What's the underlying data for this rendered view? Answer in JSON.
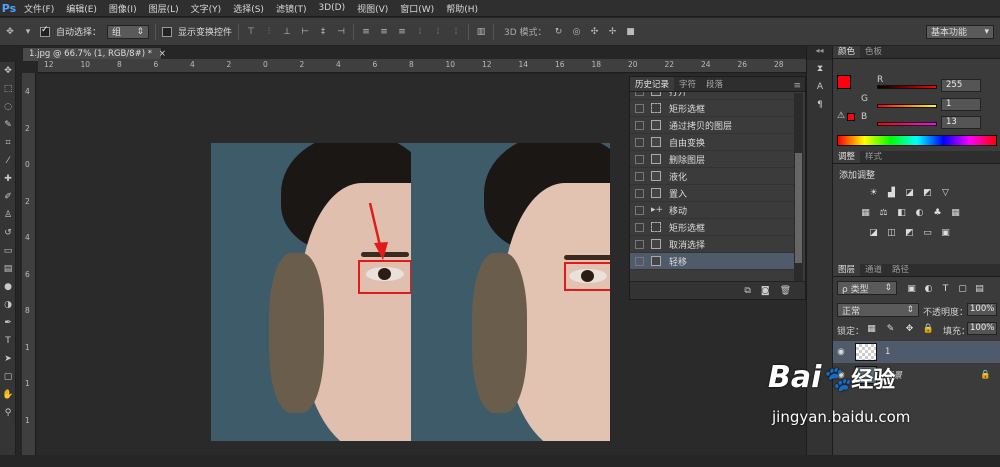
{
  "app": {
    "logo": "Ps"
  },
  "menu": [
    "文件(F)",
    "编辑(E)",
    "图像(I)",
    "图层(L)",
    "文字(Y)",
    "选择(S)",
    "滤镜(T)",
    "3D(D)",
    "视图(V)",
    "窗口(W)",
    "帮助(H)"
  ],
  "options": {
    "auto_select_label": "自动选择：",
    "auto_select_value": "组",
    "show_transform_label": "显示变换控件",
    "mode_3d_label": "3D 模式：",
    "workspace": "基本功能"
  },
  "document": {
    "tab_title": "1.jpg @ 66.7% (1, RGB/8#) *",
    "close": "×"
  },
  "ruler": {
    "top": [
      "12",
      "10",
      "8",
      "6",
      "4",
      "2",
      "0",
      "2",
      "4",
      "6",
      "8",
      "10",
      "12",
      "14",
      "16",
      "18",
      "20",
      "22",
      "24",
      "26",
      "28",
      "30"
    ],
    "left": [
      "4",
      "2",
      "0",
      "2",
      "4",
      "6",
      "8",
      "1",
      "1",
      "1"
    ]
  },
  "history_panel": {
    "tabs": [
      "历史记录",
      "字符",
      "段落"
    ],
    "items": [
      {
        "label": "打开",
        "icon": "doc-icon"
      },
      {
        "label": "矩形选框",
        "icon": "marquee-icon"
      },
      {
        "label": "通过拷贝的图层",
        "icon": "doc-icon"
      },
      {
        "label": "自由变换",
        "icon": "doc-icon"
      },
      {
        "label": "删除图层",
        "icon": "doc-icon"
      },
      {
        "label": "液化",
        "icon": "doc-icon"
      },
      {
        "label": "置入",
        "icon": "doc-icon"
      },
      {
        "label": "移动",
        "icon": "move-icon"
      },
      {
        "label": "矩形选框",
        "icon": "marquee-icon"
      },
      {
        "label": "取消选择",
        "icon": "doc-icon"
      },
      {
        "label": "轻移",
        "icon": "doc-icon"
      }
    ],
    "selected_index": 10
  },
  "color_panel": {
    "tabs": [
      "颜色",
      "色板"
    ],
    "r_label": "R",
    "g_label": "G",
    "b_label": "B",
    "r": "255",
    "g": "1",
    "b": "13",
    "foreground": "#ff010d"
  },
  "adjustments_panel": {
    "tabs": [
      "调整",
      "样式"
    ],
    "title": "添加调整"
  },
  "layers_panel": {
    "tabs": [
      "图层",
      "通道",
      "路径"
    ],
    "filter_label": "ρ 类型",
    "blend_mode": "正常",
    "opacity_label": "不透明度：",
    "opacity": "100%",
    "lock_label": "锁定：",
    "fill_label": "填充：",
    "fill": "100%",
    "layers": [
      {
        "name": "1",
        "selected": true
      },
      {
        "name": "背景",
        "selected": false
      }
    ]
  },
  "watermark": {
    "brand": "Bai",
    "brand_tail": "经验",
    "url": "jingyan.baidu.com"
  }
}
